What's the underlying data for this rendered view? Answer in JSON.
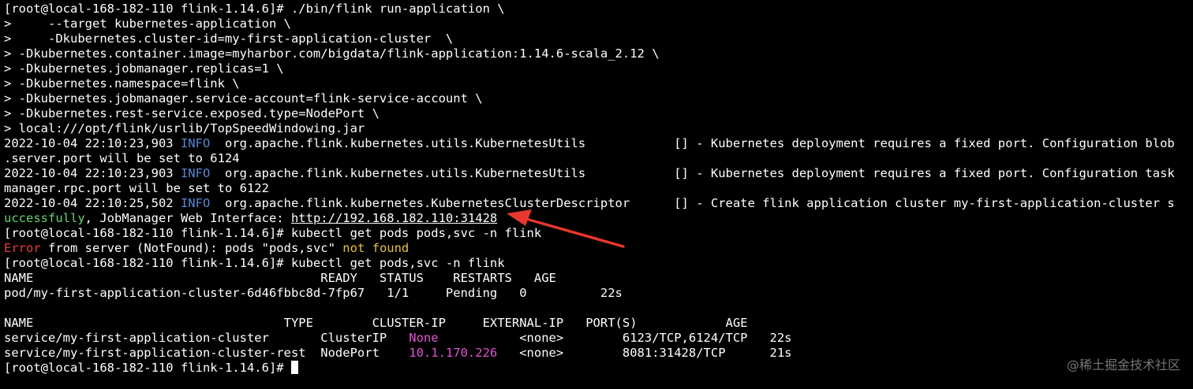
{
  "terminal": {
    "lines": [
      [
        {
          "t": "[root@local-168-182-110 flink-1.14.6]# ./bin/flink run-application \\",
          "c": "white"
        }
      ],
      [
        {
          "t": ">     --target kubernetes-application \\",
          "c": "white"
        }
      ],
      [
        {
          "t": ">     -Dkubernetes.cluster-id=my-first-application-cluster  \\",
          "c": "white"
        }
      ],
      [
        {
          "t": "> -Dkubernetes.container.image=myharbor.com/bigdata/flink-application:1.14.6-scala_2.12 \\",
          "c": "white"
        }
      ],
      [
        {
          "t": "> -Dkubernetes.jobmanager.replicas=1 \\",
          "c": "white"
        }
      ],
      [
        {
          "t": "> -Dkubernetes.namespace=flink \\",
          "c": "white"
        }
      ],
      [
        {
          "t": "> -Dkubernetes.jobmanager.service-account=flink-service-account \\",
          "c": "white"
        }
      ],
      [
        {
          "t": "> -Dkubernetes.rest-service.exposed.type=NodePort \\",
          "c": "white"
        }
      ],
      [
        {
          "t": "> local:///opt/flink/usrlib/TopSpeedWindowing.jar",
          "c": "white"
        }
      ],
      [
        {
          "t": "2022-10-04 22:10:23,903 ",
          "c": "white"
        },
        {
          "t": "INFO",
          "c": "blue"
        },
        {
          "t": "  org.apache.flink.kubernetes.utils.KubernetesUtils            [] - Kubernetes deployment requires a fixed port. Configuration blob",
          "c": "white"
        }
      ],
      [
        {
          "t": ".server.port will be set to 6124",
          "c": "white"
        }
      ],
      [
        {
          "t": "2022-10-04 22:10:23,903 ",
          "c": "white"
        },
        {
          "t": "INFO",
          "c": "blue"
        },
        {
          "t": "  org.apache.flink.kubernetes.utils.KubernetesUtils            [] - Kubernetes deployment requires a fixed port. Configuration task",
          "c": "white"
        }
      ],
      [
        {
          "t": "manager.rpc.port will be set to 6122",
          "c": "white"
        }
      ],
      [
        {
          "t": "2022-10-04 22:10:25,502 ",
          "c": "white"
        },
        {
          "t": "INFO",
          "c": "blue"
        },
        {
          "t": "  org.apache.flink.kubernetes.KubernetesClusterDescriptor      [] - Create flink application cluster my-first-application-cluster s",
          "c": "white"
        }
      ],
      [
        {
          "t": "uccessfully",
          "c": "green"
        },
        {
          "t": ", JobManager Web Interface: ",
          "c": "white"
        },
        {
          "t": "http://192.168.182.110:31428",
          "c": "white",
          "link": true
        }
      ],
      [
        {
          "t": "[root@local-168-182-110 flink-1.14.6]# kubectl get pods pods,svc -n flink",
          "c": "white"
        }
      ],
      [
        {
          "t": "Error",
          "c": "red"
        },
        {
          "t": " from server (NotFound): pods \"pods,svc\" ",
          "c": "white"
        },
        {
          "t": "not found",
          "c": "yellow"
        }
      ],
      [
        {
          "t": "[root@local-168-182-110 flink-1.14.6]# kubectl get pods,svc -n flink",
          "c": "white"
        }
      ],
      [
        {
          "t": "NAME                                       READY   STATUS    RESTARTS   AGE",
          "c": "white"
        }
      ],
      [
        {
          "t": "pod/my-first-application-cluster-6d46fbbc8d-7fp67   1/1     Pending   0          22s",
          "c": "white"
        }
      ],
      [
        {
          "t": "",
          "c": "white"
        }
      ],
      [
        {
          "t": "NAME                                  TYPE        CLUSTER-IP     EXTERNAL-IP   PORT(S)            AGE",
          "c": "white"
        }
      ],
      [
        {
          "t": "service/my-first-application-cluster       ClusterIP   ",
          "c": "white"
        },
        {
          "t": "None",
          "c": "magenta"
        },
        {
          "t": "           <none>        6123/TCP,6124/TCP   22s",
          "c": "white"
        }
      ],
      [
        {
          "t": "service/my-first-application-cluster-rest  NodePort    ",
          "c": "white"
        },
        {
          "t": "10.1.170.226",
          "c": "magenta"
        },
        {
          "t": "   <none>        8081:31428/TCP      21s",
          "c": "white"
        }
      ],
      [
        {
          "t": "[root@local-168-182-110 flink-1.14.6]# ",
          "c": "white"
        },
        {
          "t": "",
          "c": "cursor"
        }
      ]
    ]
  },
  "watermark": "@稀土掘金技术社区",
  "colors": {
    "background": "#000000",
    "text": "#ffffff",
    "info": "#5a86d6",
    "success": "#66d36e",
    "error": "#e0433b",
    "warning": "#e5c23f",
    "ip": "#e253d6",
    "annotation_arrow": "#e8372c"
  }
}
